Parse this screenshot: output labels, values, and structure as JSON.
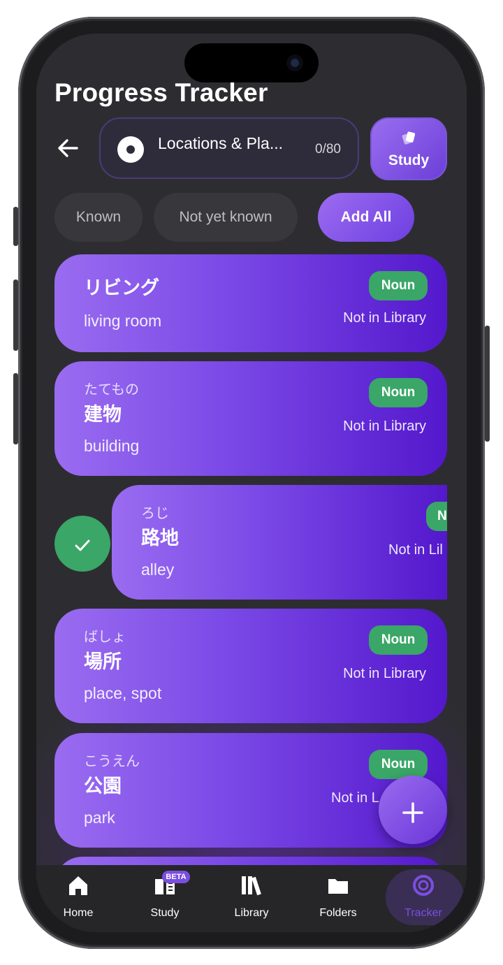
{
  "header": {
    "title": "Progress Tracker",
    "back_icon": "arrow-left-icon"
  },
  "deck": {
    "name": "Locations & Pla...",
    "count": "0/80"
  },
  "study_button": {
    "label": "Study",
    "icon": "cards-icon"
  },
  "filters": {
    "known": "Known",
    "not_yet_known": "Not yet known",
    "add_all": "Add All"
  },
  "cards": [
    {
      "kana": "",
      "kanji": "リビング",
      "meaning": "living room",
      "type": "Noun",
      "status": "Not in Library"
    },
    {
      "kana": "たてもの",
      "kanji": "建物",
      "meaning": "building",
      "type": "Noun",
      "status": "Not in Library"
    },
    {
      "kana": "ろじ",
      "kanji": "路地",
      "meaning": "alley",
      "type": "N",
      "status": "Not in Lil",
      "swiped": true
    },
    {
      "kana": "ばしょ",
      "kanji": "場所",
      "meaning": "place, spot",
      "type": "Noun",
      "status": "Not in Library"
    },
    {
      "kana": "こうえん",
      "kanji": "公園",
      "meaning": "park",
      "type": "Noun",
      "status": "Not in L"
    }
  ],
  "fab": {
    "label": "+"
  },
  "tabs": [
    {
      "label": "Home",
      "icon": "home-icon"
    },
    {
      "label": "Study",
      "icon": "book-icon",
      "badge": "BETA"
    },
    {
      "label": "Library",
      "icon": "library-icon"
    },
    {
      "label": "Folders",
      "icon": "folder-icon"
    },
    {
      "label": "Tracker",
      "icon": "tracker-ring-icon",
      "active": true
    }
  ],
  "colors": {
    "accent": "#7a4fe0",
    "card_gradient_start": "#9a6cf0",
    "card_gradient_end": "#5418cc",
    "badge_green": "#3aa667",
    "background": "#2d2d31"
  }
}
